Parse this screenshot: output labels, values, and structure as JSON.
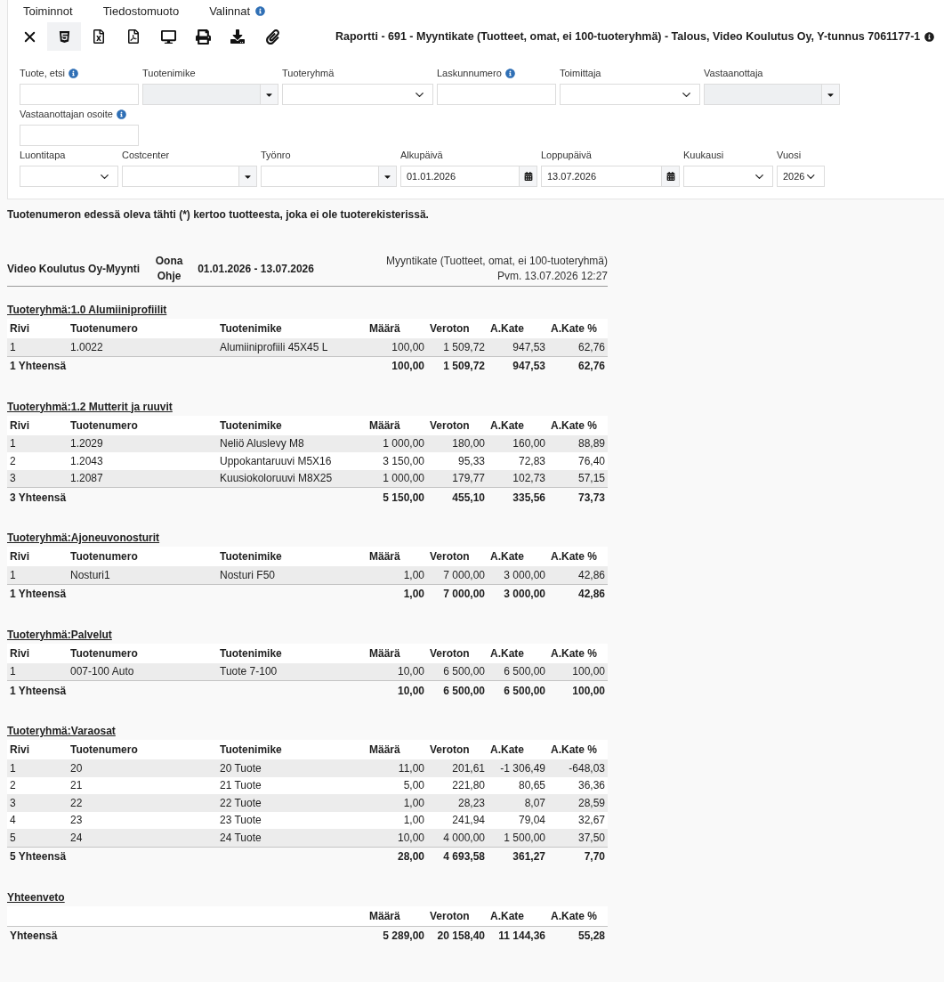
{
  "menu": [
    {
      "label": "Toiminnot",
      "info": false
    },
    {
      "label": "Tiedostomuoto",
      "info": false
    },
    {
      "label": "Valinnat",
      "info": true
    }
  ],
  "toolbar": [
    {
      "kind": "close",
      "selected": false
    },
    {
      "kind": "html",
      "selected": true
    },
    {
      "kind": "excel",
      "selected": false
    },
    {
      "kind": "pdf",
      "selected": false
    },
    {
      "kind": "screen",
      "selected": false
    },
    {
      "kind": "print",
      "selected": false
    },
    {
      "kind": "download",
      "selected": false
    },
    {
      "kind": "attach",
      "selected": false
    }
  ],
  "title": {
    "text": "Raportti - 691 - Myyntikate (Tuotteet, omat, ei 100-tuoteryhmä) - Talous, Video Koulutus Oy, Y-tunnus 7061177-1",
    "info": true
  },
  "filters": [
    [
      {
        "label": "Tuote, etsi",
        "kind": "text",
        "info": true,
        "disabled": false
      },
      {
        "label": "Tuotenimike",
        "kind": "combo",
        "info": false,
        "disabled": true
      },
      {
        "label": "Tuoteryhmä",
        "kind": "select",
        "info": false,
        "disabled": false
      },
      {
        "label": "Laskunnumero",
        "kind": "text",
        "info": true,
        "disabled": false
      },
      {
        "label": "Toimittaja",
        "kind": "select",
        "info": false,
        "disabled": false
      },
      {
        "label": "Vastaanottaja",
        "kind": "combo",
        "info": false,
        "disabled": true
      }
    ],
    [
      {
        "label": "Vastaanottajan osoite",
        "kind": "text",
        "info": true,
        "disabled": false
      }
    ],
    [
      {
        "label": "Luontitapa",
        "kind": "select",
        "info": false,
        "disabled": false
      },
      {
        "label": "Costcenter",
        "kind": "combo",
        "info": false,
        "disabled": false
      },
      {
        "label": "Työnro",
        "kind": "combo",
        "info": false,
        "disabled": false
      },
      {
        "label": "Alkupäivä",
        "kind": "date",
        "info": false,
        "disabled": false,
        "value": "01.01.2026"
      },
      {
        "label": "Loppupäivä",
        "kind": "date",
        "info": false,
        "disabled": false,
        "value": "13.07.2026"
      },
      {
        "label": "Kuukausi",
        "kind": "select",
        "info": false,
        "disabled": false
      },
      {
        "label": "Vuosi",
        "kind": "select",
        "info": false,
        "disabled": false,
        "value": "2026"
      }
    ]
  ],
  "note": "Tuotenumeron edessä oleva tähti (*) kertoo tuotteesta, joka ei ole tuoterekisterissä.",
  "report_header": {
    "company": "Video Koulutus Oy-Myynti",
    "user": "Oona Ohje",
    "period": "01.01.2026 - 13.07.2026",
    "report_name": "Myyntikate (Tuotteet, omat, ei 100-tuoteryhmä)",
    "printed": "Pvm. 13.07.2026 12:27"
  },
  "groups": [
    {
      "title": "Tuoteryhmä:1.0 Alumiiniprofiilit",
      "columns": [
        "Rivi",
        "Tuotenumero",
        "Tuotenimike",
        "Määrä",
        "Veroton",
        "A.Kate",
        "A.Kate %"
      ],
      "rows": [
        [
          "1",
          "1.0022",
          "Alumiiniprofiili 45X45 L",
          "100,00",
          "1 509,72",
          "947,53",
          "62,76"
        ]
      ],
      "total": {
        "label": "1 Yhteensä",
        "values": [
          "100,00",
          "1 509,72",
          "947,53",
          "62,76"
        ]
      }
    },
    {
      "title": "Tuoteryhmä:1.2 Mutterit ja ruuvit",
      "columns": [
        "Rivi",
        "Tuotenumero",
        "Tuotenimike",
        "Määrä",
        "Veroton",
        "A.Kate",
        "A.Kate %"
      ],
      "rows": [
        [
          "1",
          "1.2029",
          "Neliö Aluslevy M8",
          "1 000,00",
          "180,00",
          "160,00",
          "88,89"
        ],
        [
          "2",
          "1.2043",
          "Uppokantaruuvi M5X16",
          "3 150,00",
          "95,33",
          "72,83",
          "76,40"
        ],
        [
          "3",
          "1.2087",
          "Kuusiokoloruuvi M8X25",
          "1 000,00",
          "179,77",
          "102,73",
          "57,15"
        ]
      ],
      "total": {
        "label": "3 Yhteensä",
        "values": [
          "5 150,00",
          "455,10",
          "335,56",
          "73,73"
        ]
      }
    },
    {
      "title": "Tuoteryhmä:Ajoneuvonosturit",
      "columns": [
        "Rivi",
        "Tuotenumero",
        "Tuotenimike",
        "Määrä",
        "Veroton",
        "A.Kate",
        "A.Kate %"
      ],
      "rows": [
        [
          "1",
          "Nosturi1",
          "Nosturi F50",
          "1,00",
          "7 000,00",
          "3 000,00",
          "42,86"
        ]
      ],
      "total": {
        "label": "1 Yhteensä",
        "values": [
          "1,00",
          "7 000,00",
          "3 000,00",
          "42,86"
        ]
      }
    },
    {
      "title": "Tuoteryhmä:Palvelut",
      "columns": [
        "Rivi",
        "Tuotenumero",
        "Tuotenimike",
        "Määrä",
        "Veroton",
        "A.Kate",
        "A.Kate %"
      ],
      "rows": [
        [
          "1",
          "007-100 Auto",
          "Tuote 7-100",
          "10,00",
          "6 500,00",
          "6 500,00",
          "100,00"
        ]
      ],
      "total": {
        "label": "1 Yhteensä",
        "values": [
          "10,00",
          "6 500,00",
          "6 500,00",
          "100,00"
        ]
      }
    },
    {
      "title": "Tuoteryhmä:Varaosat",
      "columns": [
        "Rivi",
        "Tuotenumero",
        "Tuotenimike",
        "Määrä",
        "Veroton",
        "A.Kate",
        "A.Kate %"
      ],
      "rows": [
        [
          "1",
          "20",
          "20 Tuote",
          "11,00",
          "201,61",
          "-1 306,49",
          "-648,03"
        ],
        [
          "2",
          "21",
          "21 Tuote",
          "5,00",
          "221,80",
          "80,65",
          "36,36"
        ],
        [
          "3",
          "22",
          "22 Tuote",
          "1,00",
          "28,23",
          "8,07",
          "28,59"
        ],
        [
          "4",
          "23",
          "23 Tuote",
          "1,00",
          "241,94",
          "79,04",
          "32,67"
        ],
        [
          "5",
          "24",
          "24 Tuote",
          "10,00",
          "4 000,00",
          "1 500,00",
          "37,50"
        ]
      ],
      "total": {
        "label": "5 Yhteensä",
        "values": [
          "28,00",
          "4 693,58",
          "361,27",
          "7,70"
        ]
      }
    }
  ],
  "summary": {
    "title": "Yhteenveto",
    "columns": [
      "Määrä",
      "Veroton",
      "A.Kate",
      "A.Kate %"
    ],
    "total": {
      "label": "Yhteensä",
      "values": [
        "5 289,00",
        "20 158,40",
        "11 144,36",
        "55,28"
      ]
    }
  }
}
